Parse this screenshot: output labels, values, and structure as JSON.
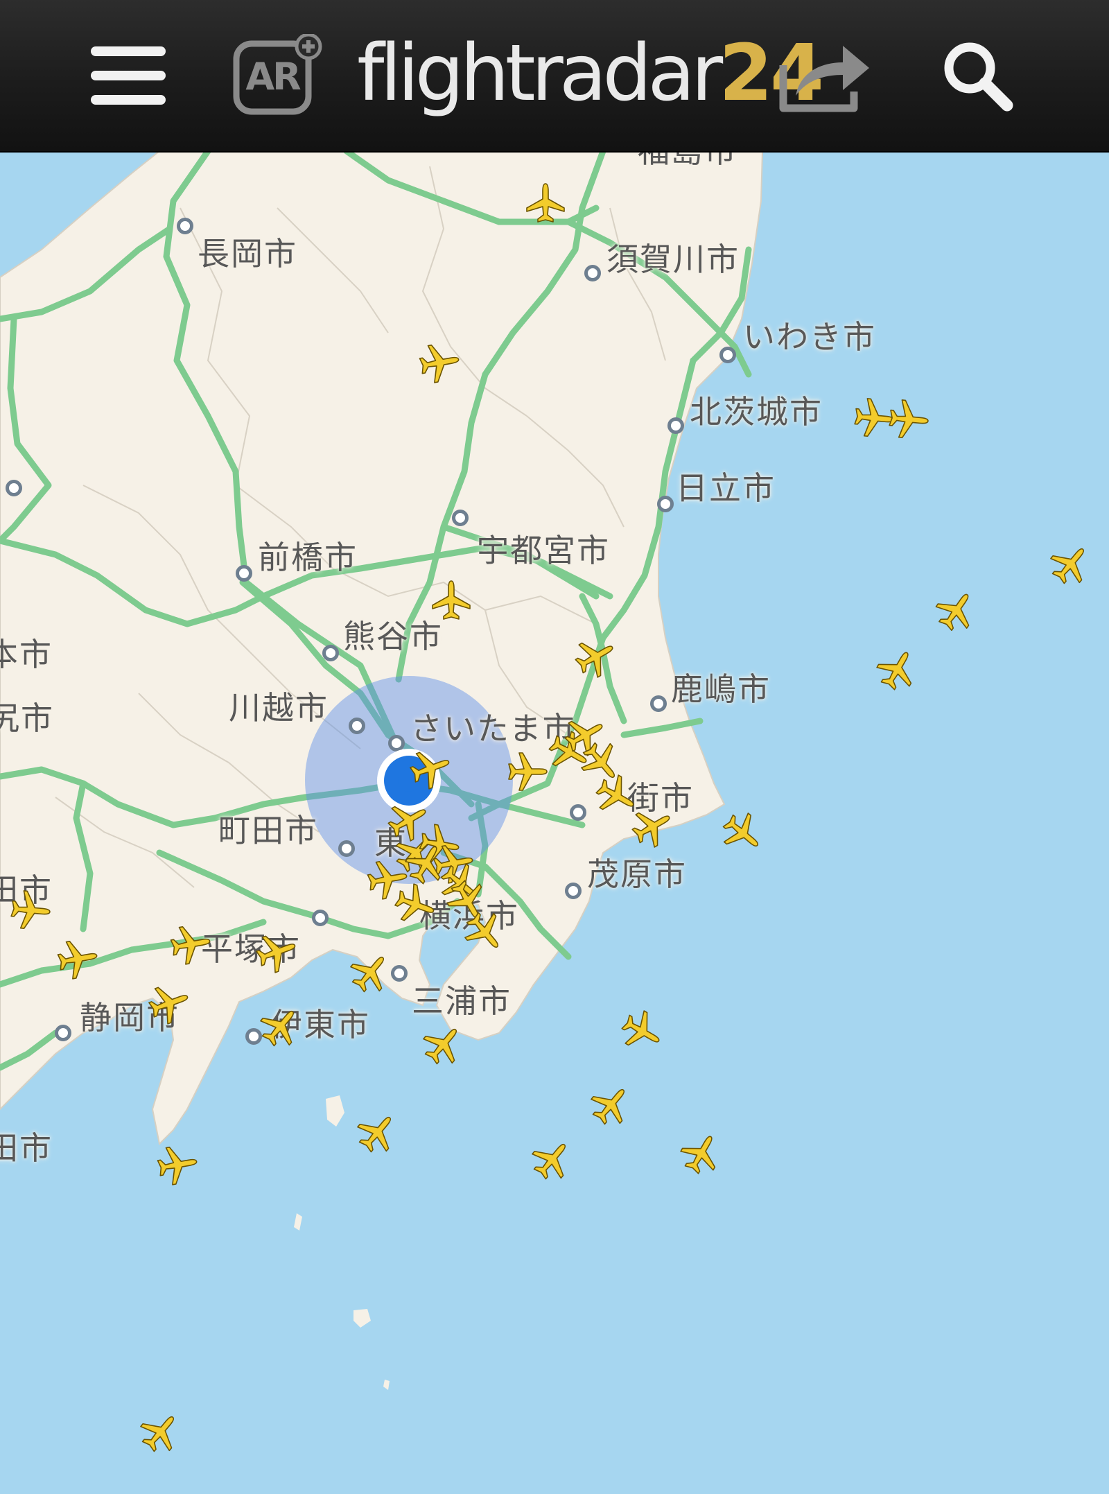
{
  "app": {
    "logo_text": "flightradar",
    "logo_number": "24"
  },
  "toolbar": {
    "ar_label": "AR"
  },
  "colors": {
    "sea": "#a6d6f0",
    "land": "#f6f1e7",
    "roads": "#7ecb8f",
    "plane": "#f3cc2c",
    "accent": "#1f76e0",
    "logo_number": "#d8b24a"
  },
  "icons": [
    "menu-icon",
    "ar-icon",
    "share-icon",
    "search-icon",
    "plane-icon",
    "my-location-icon"
  ],
  "cities": [
    {
      "id": "nagaoka",
      "name": "長岡市"
    },
    {
      "id": "sukagawa",
      "name": "須賀川市"
    },
    {
      "id": "iwaki",
      "name": "いわき市"
    },
    {
      "id": "kitaibaraki",
      "name": "北茨城市"
    },
    {
      "id": "hitachi",
      "name": "日立市"
    },
    {
      "id": "utsunomiya",
      "name": "宇都宮市"
    },
    {
      "id": "maebashi",
      "name": "前橋市"
    },
    {
      "id": "kumagaya",
      "name": "熊谷市"
    },
    {
      "id": "kawagoe",
      "name": "川越市"
    },
    {
      "id": "saitama",
      "name": "さいたま市"
    },
    {
      "id": "kashima",
      "name": "鹿嶋市"
    },
    {
      "id": "machida",
      "name": "町田市"
    },
    {
      "id": "tokyo",
      "name": "東"
    },
    {
      "id": "mobara",
      "name": "茂原市"
    },
    {
      "id": "yokohama",
      "name": "横浜市"
    },
    {
      "id": "hiratsuka",
      "name": "平塚市"
    },
    {
      "id": "miura",
      "name": "三浦市"
    },
    {
      "id": "ito",
      "name": "伊東市"
    },
    {
      "id": "shizuoka",
      "name": "静岡市"
    },
    {
      "id": "chiba-partial",
      "name": "街市"
    },
    {
      "id": "left-1",
      "name": "本市"
    },
    {
      "id": "left-2",
      "name": "尻市"
    },
    {
      "id": "left-3",
      "name": "田市"
    },
    {
      "id": "left-4",
      "name": "田市"
    },
    {
      "id": "top-partial",
      "name": "福島市"
    }
  ]
}
